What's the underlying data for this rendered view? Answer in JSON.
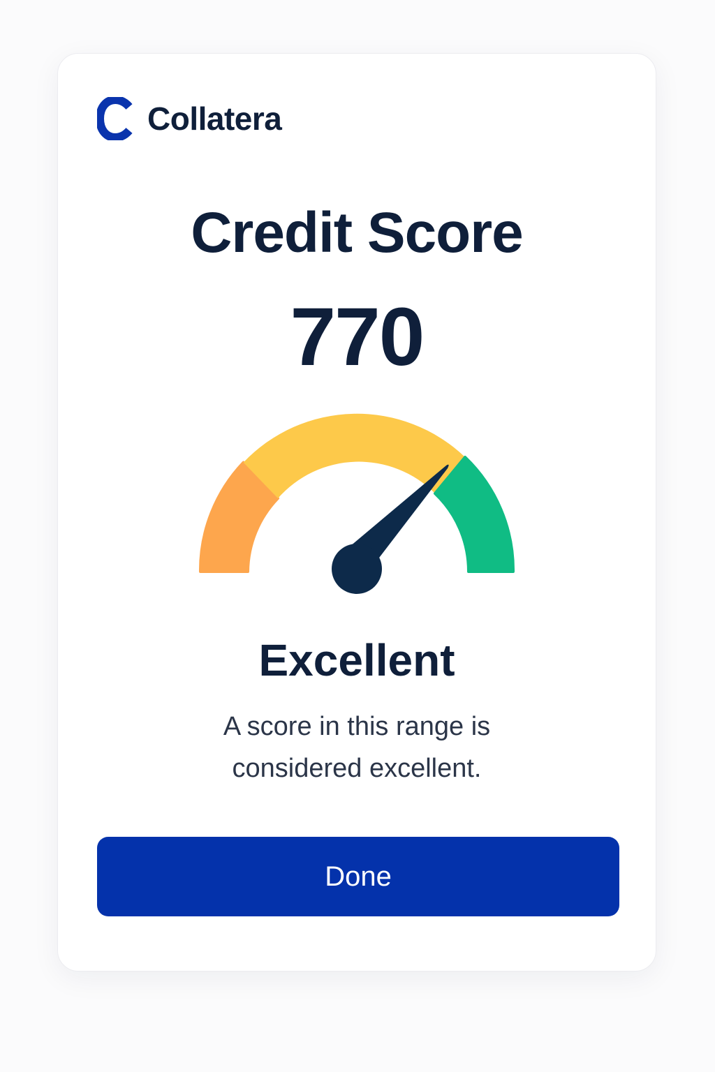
{
  "brand": {
    "name": "Collatera",
    "mark_letter": "C",
    "mark_color": "#0a34ad"
  },
  "title": "Credit Score",
  "score": {
    "value": "770",
    "rating": "Excellent",
    "description": "A score in this range is considered excellent.",
    "needle_position_fraction": 0.82
  },
  "gauge": {
    "segments": [
      {
        "color": "#fda64d"
      },
      {
        "color": "#fdc94a"
      },
      {
        "color": "#10bc84"
      }
    ],
    "needle_color": "#0d2a4a"
  },
  "actions": {
    "done_label": "Done",
    "done_color": "#0432ab"
  }
}
